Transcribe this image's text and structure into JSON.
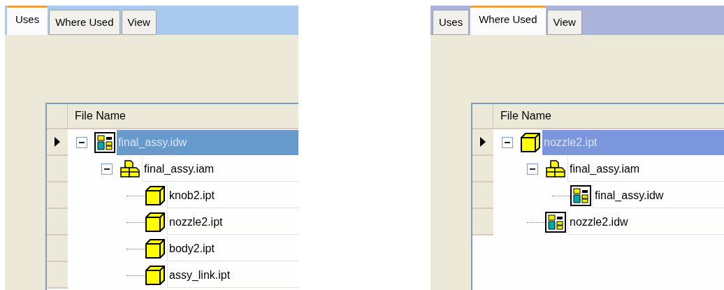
{
  "panels": [
    {
      "tabs": [
        {
          "label": "Uses",
          "selected": true
        },
        {
          "label": "Where Used",
          "selected": false
        },
        {
          "label": "View",
          "selected": false
        }
      ],
      "column": "File Name",
      "tree": [
        {
          "name": "final_assy.idw",
          "kind": "drawing",
          "selected": true,
          "expanded": true,
          "children": [
            {
              "name": "final_assy.iam",
              "kind": "assembly",
              "selected": false,
              "expanded": true,
              "children": [
                {
                  "name": "knob2.ipt",
                  "kind": "part",
                  "selected": false
                },
                {
                  "name": "nozzle2.ipt",
                  "kind": "part",
                  "selected": false
                },
                {
                  "name": "body2.ipt",
                  "kind": "part",
                  "selected": false
                },
                {
                  "name": "assy_link.ipt",
                  "kind": "part",
                  "selected": false
                }
              ]
            }
          ]
        }
      ]
    },
    {
      "tabs": [
        {
          "label": "Uses",
          "selected": false
        },
        {
          "label": "Where Used",
          "selected": true
        },
        {
          "label": "View",
          "selected": false
        }
      ],
      "column": "File Name",
      "tree": [
        {
          "name": "nozzle2.ipt",
          "kind": "part",
          "selected": true,
          "expanded": true,
          "children": [
            {
              "name": "final_assy.iam",
              "kind": "assembly",
              "selected": false,
              "expanded": true,
              "children": [
                {
                  "name": "final_assy.idw",
                  "kind": "drawing",
                  "selected": false
                }
              ]
            },
            {
              "name": "nozzle2.idw",
              "kind": "drawing",
              "selected": false
            }
          ]
        }
      ]
    }
  ]
}
